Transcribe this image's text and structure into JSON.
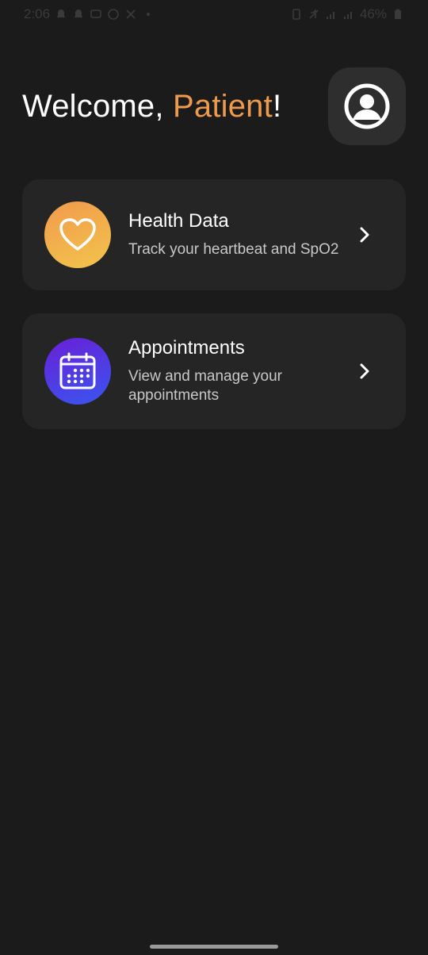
{
  "status_bar": {
    "time": "2:06",
    "battery": "46%",
    "icons": [
      "notification-icon",
      "notification-icon",
      "message-icon",
      "whatsapp-icon",
      "cross-icon",
      "dot-icon",
      "alarm-icon",
      "mute-icon",
      "signal-icon",
      "signal-icon",
      "battery-icon"
    ]
  },
  "header": {
    "greeting": "Welcome, ",
    "name": "Patient",
    "punctuation": "!",
    "name_color": "#ee9a4d"
  },
  "cards": [
    {
      "title": "Health Data",
      "subtitle": "Track your heartbeat and SpO2",
      "icon": "heart-icon",
      "gradient": [
        "#f19a4d",
        "#f3c44c"
      ]
    },
    {
      "title": "Appointments",
      "subtitle": "View and manage your appointments",
      "icon": "calendar-icon",
      "gradient": [
        "#6a1fd6",
        "#3956f0"
      ]
    }
  ],
  "colors": {
    "background": "#1b1b1b",
    "card": "#252525",
    "accent": "#ee9a4d"
  }
}
